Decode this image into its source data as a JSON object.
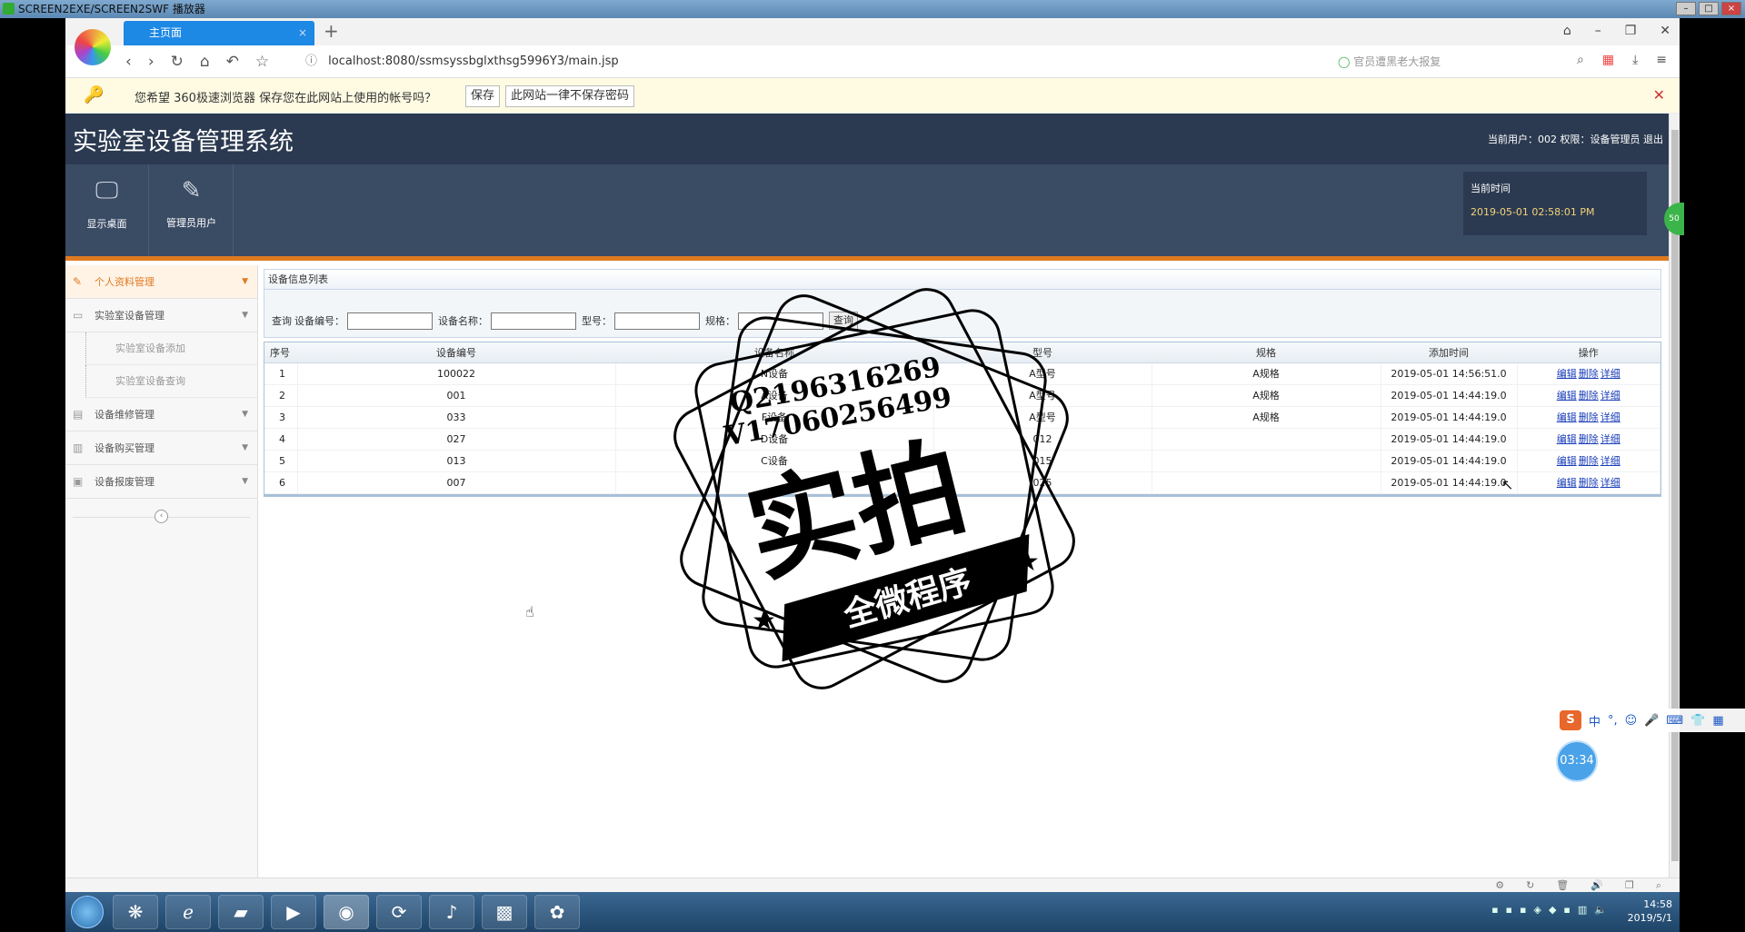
{
  "window": {
    "title": "SCREEN2EXE/SCREEN2SWF 播放器"
  },
  "browser": {
    "tab_title": "主页面",
    "url": "localhost:8080/ssmsyssbglxthsg5996Y3/main.jsp",
    "search_placeholder": "官员遭黑老大报复"
  },
  "password_bar": {
    "message": "您希望 360极速浏览器 保存您在此网站上使用的帐号吗？",
    "save_label": "保存",
    "never_label": "此网站一律不保存密码"
  },
  "app": {
    "title": "实验室设备管理系统",
    "user_info": "当前用户：002  权限：设备管理员  退出",
    "toolbar": [
      {
        "label": "显示桌面",
        "icon": "monitor-icon"
      },
      {
        "label": "管理员用户",
        "icon": "pencil-icon"
      }
    ],
    "time_label": "当前时间",
    "time_value": "2019-05-01 02:58:01 PM"
  },
  "sidebar": {
    "items": [
      {
        "label": "个人资料管理",
        "icon": "pencil-icon",
        "active": true
      },
      {
        "label": "实验室设备管理",
        "icon": "device-icon",
        "active": false
      }
    ],
    "subitems": [
      "实验室设备添加",
      "实验室设备查询"
    ],
    "items2": [
      {
        "label": "设备维修管理",
        "icon": "repair-icon"
      },
      {
        "label": "设备购买管理",
        "icon": "cart-icon"
      },
      {
        "label": "设备报废管理",
        "icon": "scrap-icon"
      }
    ]
  },
  "panel": {
    "title": "设备信息列表",
    "search": {
      "prefix": "查询",
      "field1": "设备编号：",
      "field2": "设备名称：",
      "field3": "型号：",
      "field4": "规格：",
      "button": "查询"
    },
    "columns": [
      "序号",
      "设备编号",
      "设备名称",
      "型号",
      "规格",
      "添加时间",
      "操作"
    ],
    "rows": [
      {
        "seq": "1",
        "code": "100022",
        "name": "N设备",
        "model": "A型号",
        "spec": "A规格",
        "time": "2019-05-01 14:56:51.0"
      },
      {
        "seq": "2",
        "code": "001",
        "name": "A设备",
        "model": "A型号",
        "spec": "A规格",
        "time": "2019-05-01 14:44:19.0"
      },
      {
        "seq": "3",
        "code": "033",
        "name": "F设备",
        "model": "A型号",
        "spec": "A规格",
        "time": "2019-05-01 14:44:19.0"
      },
      {
        "seq": "4",
        "code": "027",
        "name": "D设备",
        "model": "012",
        "spec": "",
        "time": "2019-05-01 14:44:19.0"
      },
      {
        "seq": "5",
        "code": "013",
        "name": "C设备",
        "model": "015",
        "spec": "",
        "time": "2019-05-01 14:44:19.0"
      },
      {
        "seq": "6",
        "code": "007",
        "name": "",
        "model": "025",
        "spec": "",
        "time": "2019-05-01 14:44:19.0"
      }
    ],
    "actions": [
      "编辑",
      "删除",
      "详细"
    ]
  },
  "watermark": {
    "line1": "Q2196316269",
    "line2": "V17060256499",
    "big": "实拍",
    "ribbon": "全微程序"
  },
  "floating": {
    "recorder_time": "03:34",
    "ime_label": "中",
    "side_badge": "50"
  },
  "taskbar": {
    "clock_time": "14:58",
    "clock_date": "2019/5/1"
  }
}
